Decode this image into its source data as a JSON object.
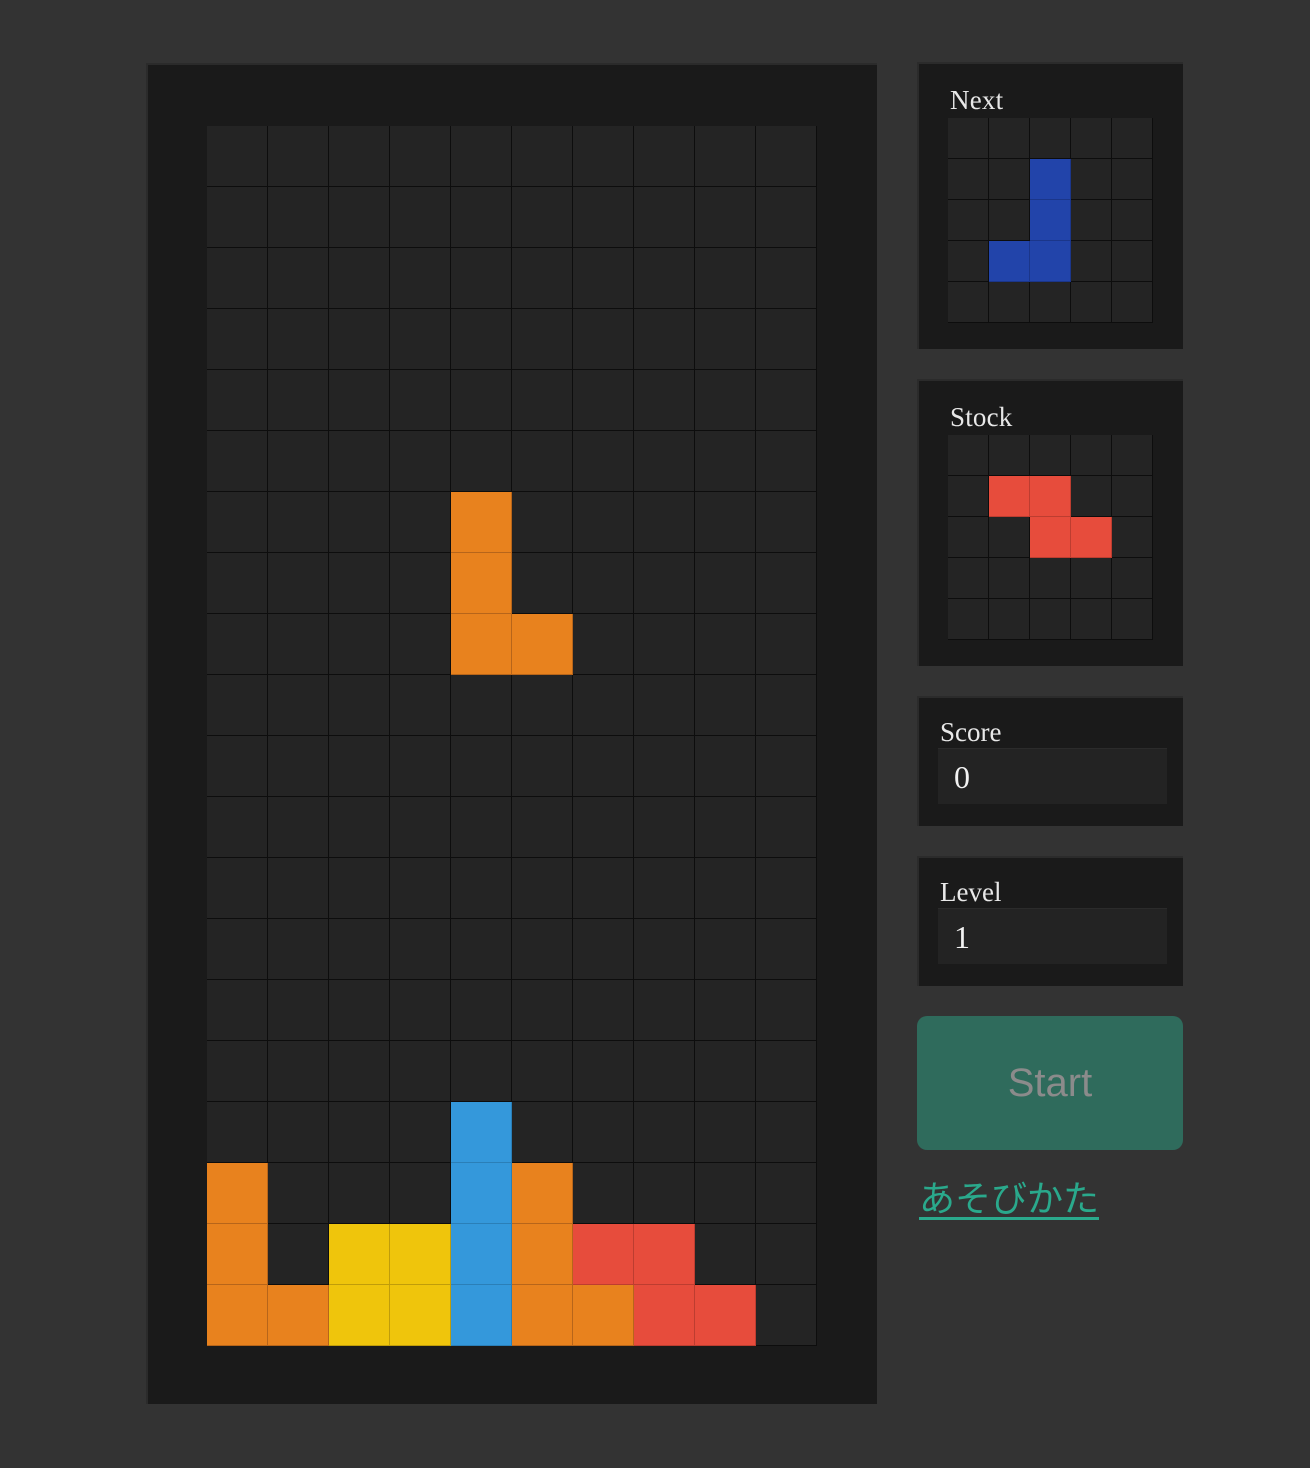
{
  "app": {
    "background_color": "#333333",
    "panel_color": "#1a1a1a"
  },
  "colors": {
    "orange": "#e8821e",
    "yellow": "#efc50c",
    "cyan": "#3498db",
    "red": "#e74c3c",
    "blue": "#2244aa",
    "empty": "#242424",
    "accent_teal": "#2aa98c",
    "start_button_bg": "#2f6b5c",
    "start_button_text": "#8b8b8b"
  },
  "board": {
    "columns": 10,
    "rows": 20,
    "cell_size_px": 61,
    "cells": [
      [
        "",
        "",
        "",
        "",
        "",
        "",
        "",
        "",
        "",
        ""
      ],
      [
        "",
        "",
        "",
        "",
        "",
        "",
        "",
        "",
        "",
        ""
      ],
      [
        "",
        "",
        "",
        "",
        "",
        "",
        "",
        "",
        "",
        ""
      ],
      [
        "",
        "",
        "",
        "",
        "",
        "",
        "",
        "",
        "",
        ""
      ],
      [
        "",
        "",
        "",
        "",
        "",
        "",
        "",
        "",
        "",
        ""
      ],
      [
        "",
        "",
        "",
        "",
        "",
        "",
        "",
        "",
        "",
        ""
      ],
      [
        "",
        "",
        "",
        "",
        "orange",
        "",
        "",
        "",
        "",
        ""
      ],
      [
        "",
        "",
        "",
        "",
        "orange",
        "",
        "",
        "",
        "",
        ""
      ],
      [
        "",
        "",
        "",
        "",
        "orange",
        "orange",
        "",
        "",
        "",
        ""
      ],
      [
        "",
        "",
        "",
        "",
        "",
        "",
        "",
        "",
        "",
        ""
      ],
      [
        "",
        "",
        "",
        "",
        "",
        "",
        "",
        "",
        "",
        ""
      ],
      [
        "",
        "",
        "",
        "",
        "",
        "",
        "",
        "",
        "",
        ""
      ],
      [
        "",
        "",
        "",
        "",
        "",
        "",
        "",
        "",
        "",
        ""
      ],
      [
        "",
        "",
        "",
        "",
        "",
        "",
        "",
        "",
        "",
        ""
      ],
      [
        "",
        "",
        "",
        "",
        "",
        "",
        "",
        "",
        "",
        ""
      ],
      [
        "",
        "",
        "",
        "",
        "",
        "",
        "",
        "",
        "",
        ""
      ],
      [
        "",
        "",
        "",
        "",
        "cyan",
        "",
        "",
        "",
        "",
        ""
      ],
      [
        "orange",
        "",
        "",
        "",
        "cyan",
        "orange",
        "",
        "",
        "",
        ""
      ],
      [
        "orange",
        "",
        "yellow",
        "yellow",
        "cyan",
        "orange",
        "red",
        "red",
        "",
        ""
      ],
      [
        "orange",
        "orange",
        "yellow",
        "yellow",
        "cyan",
        "orange",
        "orange",
        "red",
        "red",
        ""
      ]
    ]
  },
  "next_panel": {
    "title": "Next",
    "piece_name": "j-piece",
    "columns": 5,
    "rows": 5,
    "cells": [
      [
        "",
        "",
        "",
        "",
        ""
      ],
      [
        "",
        "",
        "blue",
        "",
        ""
      ],
      [
        "",
        "",
        "blue",
        "",
        ""
      ],
      [
        "",
        "blue",
        "blue",
        "",
        ""
      ],
      [
        "",
        "",
        "",
        "",
        ""
      ]
    ]
  },
  "stock_panel": {
    "title": "Stock",
    "piece_name": "z-piece",
    "columns": 5,
    "rows": 5,
    "cells": [
      [
        "",
        "",
        "",
        "",
        ""
      ],
      [
        "",
        "red",
        "red",
        "",
        ""
      ],
      [
        "",
        "",
        "red",
        "red",
        ""
      ],
      [
        "",
        "",
        "",
        "",
        ""
      ],
      [
        "",
        "",
        "",
        "",
        ""
      ]
    ]
  },
  "score_panel": {
    "title": "Score",
    "value": "0"
  },
  "level_panel": {
    "title": "Level",
    "value": "1"
  },
  "controls": {
    "start_label": "Start",
    "howto_label": "あそびかた"
  }
}
